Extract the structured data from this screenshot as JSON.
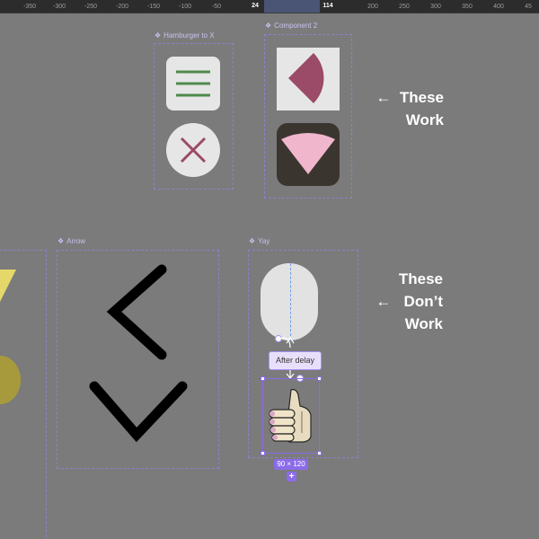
{
  "ruler": {
    "ticks": [
      "-350",
      "-300",
      "-250",
      "-200",
      "-150",
      "-100",
      "-50",
      "200",
      "250",
      "300",
      "350",
      "400",
      "45"
    ],
    "selection_start": "24",
    "selection_end": "114"
  },
  "frames": {
    "hamburger": {
      "label": "Hamburger to X"
    },
    "component2": {
      "label": "Component 2"
    },
    "arrow": {
      "label": "Arrow"
    },
    "yay": {
      "label": "Yay"
    }
  },
  "notes": {
    "work": "←  These\nWork",
    "dont_work": "These\n←   Don’t\nWork"
  },
  "prototype": {
    "trigger_label": "After delay",
    "size_badge": "90 × 120",
    "add_label": "+"
  },
  "colors": {
    "canvas": "#7b7b7b",
    "selection_purple": "#8c6bea",
    "hamburger_green": "#4f8a4c",
    "x_mauve": "#9b4a68",
    "wedge_dark": "#9b4a68",
    "wedge_pink": "#f0b6cc",
    "yellow_shape": "#e6d76a"
  },
  "icons": [
    "hamburger-icon",
    "close-x-icon",
    "pie-wedge-icon",
    "fan-wedge-icon",
    "chevron-left-icon",
    "chevron-down-icon",
    "thumbs-up-icon"
  ]
}
